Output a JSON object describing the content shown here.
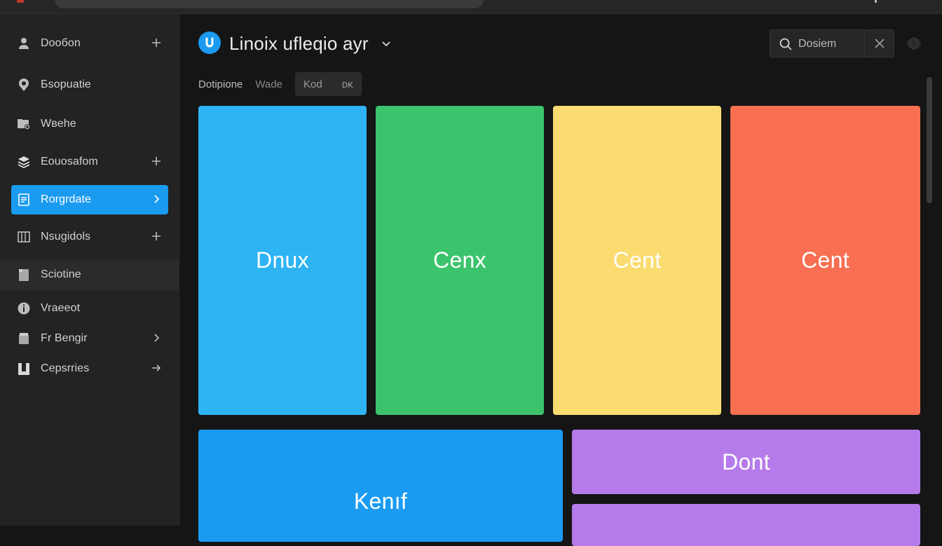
{
  "sidebar": {
    "items": [
      {
        "label": "Doобon",
        "icon": "user-icon",
        "trail": "plus"
      },
      {
        "label": "Бsopuatie",
        "icon": "location-icon",
        "trail": ""
      },
      {
        "label": "Wвehe",
        "icon": "folder-settings-icon",
        "trail": ""
      },
      {
        "label": "Eouosafom",
        "icon": "layers-icon",
        "trail": "plus"
      },
      {
        "label": "Rorgrdate",
        "icon": "document-icon",
        "trail": "chevron"
      },
      {
        "label": "Nsugidols",
        "icon": "grid-icon",
        "trail": "plus"
      },
      {
        "label": "Sciotine",
        "icon": "file-icon",
        "trail": ""
      },
      {
        "label": "Vraeeot",
        "icon": "info-icon",
        "trail": ""
      },
      {
        "label": "Fr Bengir",
        "icon": "archive-icon",
        "trail": "chevron"
      },
      {
        "label": "Cepsrries",
        "icon": "bookmark-icon",
        "trail": "arrow"
      }
    ],
    "active_index": 4
  },
  "header": {
    "title": "Linoix ufleqio ayr",
    "search_placeholder": "Dosiem"
  },
  "tabs": {
    "primary": "Dotipione",
    "secondary": "Wade",
    "group": [
      "Kod",
      "ᴅᴋ"
    ]
  },
  "tiles": [
    {
      "label": "Dnux",
      "color": "#2eb4f3"
    },
    {
      "label": "Cenx",
      "color": "#3cc46d"
    },
    {
      "label": "Cent",
      "color": "#fbdc71"
    },
    {
      "label": "Cent",
      "color": "#f86f52"
    },
    {
      "label": "Kenıf",
      "color": "#1a9bf2"
    },
    {
      "label": "Dont",
      "color": "#b57bea"
    },
    {
      "label": "",
      "color": "#b57bea"
    }
  ],
  "colors": {
    "accent": "#1a9bf0",
    "sidebar_bg": "#232323",
    "main_bg": "#151515"
  }
}
